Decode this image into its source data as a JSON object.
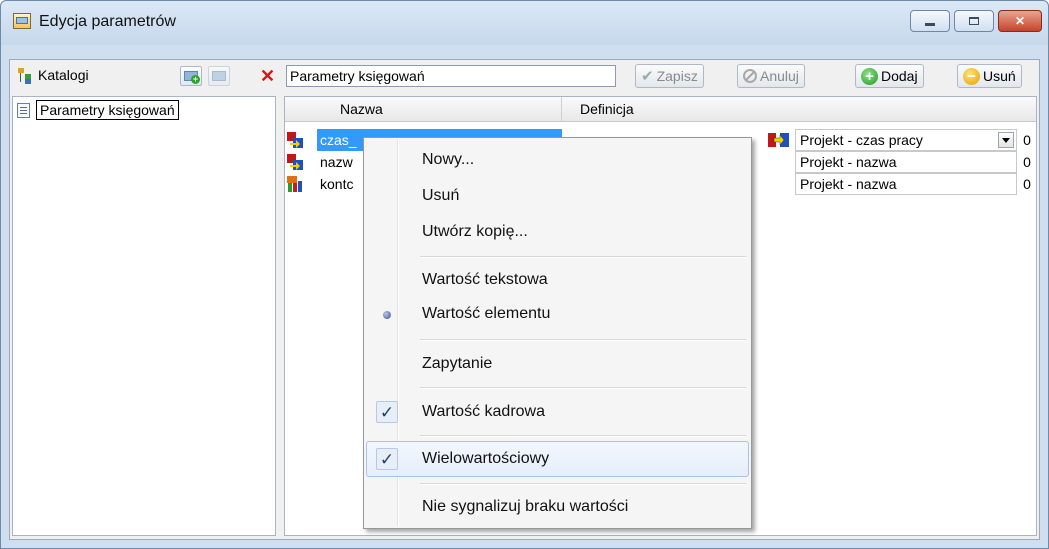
{
  "window": {
    "title": "Edycja parametrów",
    "icon": "app-window-icon"
  },
  "left_panel": {
    "toolbar_label": "Katalogi",
    "tree": [
      {
        "label": "Parametry księgowań"
      }
    ]
  },
  "right_panel": {
    "name_field_value": "Parametry księgowań",
    "buttons": {
      "save": "Zapisz",
      "cancel": "Anuluj",
      "add": "Dodaj",
      "remove": "Usuń"
    },
    "columns": [
      "Nazwa",
      "Definicja"
    ],
    "rows": [
      {
        "name": "czas_",
        "definition": "Projekt - czas pracy",
        "count": "0",
        "selected": true
      },
      {
        "name": "nazw",
        "definition": "Projekt - nazwa",
        "count": "0",
        "selected": false
      },
      {
        "name": "kontc",
        "definition": "Projekt - nazwa",
        "count": "0",
        "selected": false
      }
    ]
  },
  "context_menu": {
    "items": [
      {
        "label": "Nowy...",
        "mark": ""
      },
      {
        "label": "Usuń",
        "mark": ""
      },
      {
        "label": "Utwórz kopię...",
        "mark": ""
      },
      {
        "label": "Wartość tekstowa",
        "mark": ""
      },
      {
        "label": "Wartość elementu",
        "mark": "radio"
      },
      {
        "label": "Zapytanie",
        "mark": ""
      },
      {
        "label": "Wartość kadrowa",
        "mark": "check"
      },
      {
        "label": "Wielowartościowy",
        "mark": "check",
        "hovered": true
      },
      {
        "label": "Nie sygnalizuj braku wartości",
        "mark": ""
      }
    ]
  },
  "colors": {
    "selection": "#3399ff",
    "close_button": "#c7432b",
    "delete_x": "#d01818"
  }
}
